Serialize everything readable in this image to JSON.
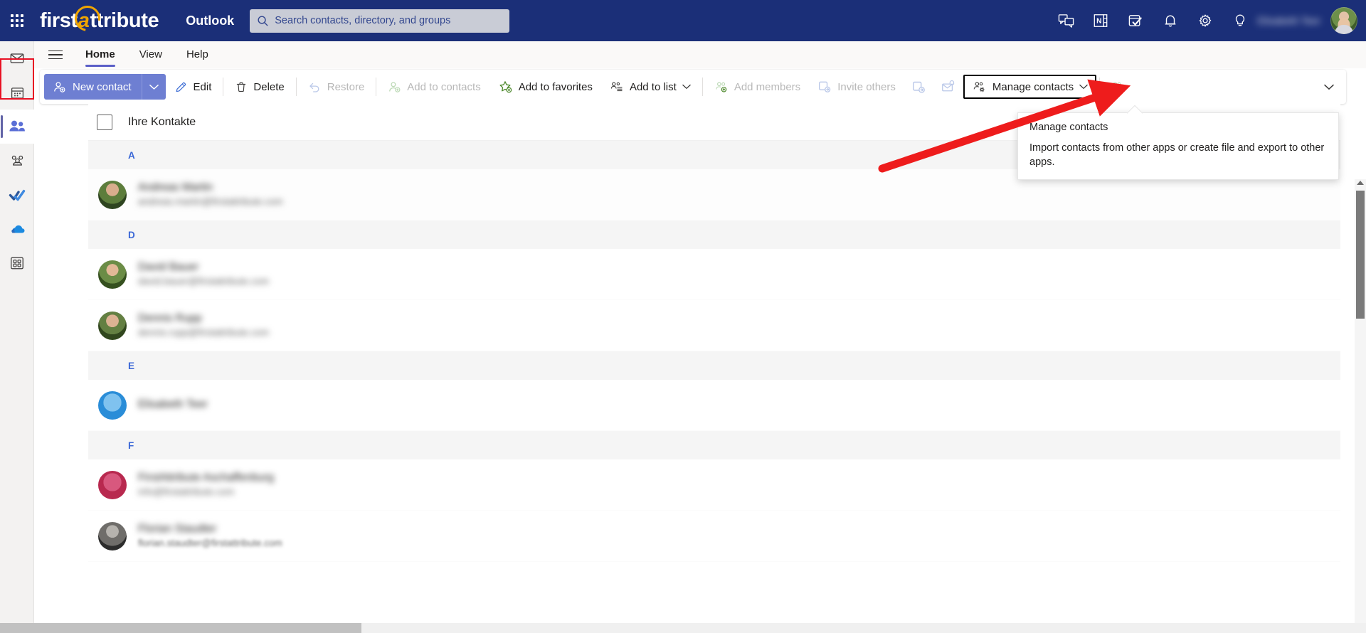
{
  "header": {
    "brand_first": "first",
    "brand_at": "a",
    "brand_rest": "ttribute",
    "app_name": "Outlook",
    "search_placeholder": "Search contacts, directory, and groups",
    "search_value": "",
    "user_name": "Elisabeth Teer",
    "icons": [
      {
        "name": "teams-chat-icon",
        "glyph": "chat"
      },
      {
        "name": "onenote-icon",
        "glyph": "onenote"
      },
      {
        "name": "todo-icon",
        "glyph": "todo"
      },
      {
        "name": "notifications-bell-icon",
        "glyph": "bell"
      },
      {
        "name": "settings-gear-icon",
        "glyph": "gear"
      },
      {
        "name": "tips-lightbulb-icon",
        "glyph": "bulb"
      }
    ]
  },
  "rail": {
    "items": [
      {
        "name": "mail",
        "label": "Mail",
        "selected": false
      },
      {
        "name": "calendar",
        "label": "Calendar",
        "selected": false
      },
      {
        "name": "people",
        "label": "People",
        "selected": true
      },
      {
        "name": "groups",
        "label": "Groups",
        "selected": false
      },
      {
        "name": "todo",
        "label": "To Do",
        "selected": false
      },
      {
        "name": "onedrive",
        "label": "OneDrive",
        "selected": false
      },
      {
        "name": "apps",
        "label": "All apps",
        "selected": false
      }
    ]
  },
  "ribbon": {
    "tabs": [
      {
        "label": "Home",
        "active": true
      },
      {
        "label": "View",
        "active": false
      },
      {
        "label": "Help",
        "active": false
      }
    ]
  },
  "toolbar": {
    "new_contact": "New contact",
    "items": [
      {
        "label": "Edit",
        "icon": "pencil-icon",
        "disabled": false,
        "chevron": false
      },
      {
        "label": "Delete",
        "icon": "trash-icon",
        "disabled": false,
        "chevron": false
      },
      {
        "label": "Restore",
        "icon": "undo-icon",
        "disabled": true,
        "chevron": false
      },
      {
        "label": "Add to contacts",
        "icon": "add-person-icon",
        "disabled": true,
        "chevron": false
      },
      {
        "label": "Add to favorites",
        "icon": "star-plus-icon",
        "disabled": false,
        "chevron": false
      },
      {
        "label": "Add to list",
        "icon": "list-people-icon",
        "disabled": false,
        "chevron": true
      },
      {
        "label": "Add members",
        "icon": "add-members-icon",
        "disabled": true,
        "chevron": false
      },
      {
        "label": "Invite others",
        "icon": "invite-icon",
        "disabled": true,
        "chevron": false
      }
    ],
    "icon_only": [
      {
        "name": "share-contact-icon",
        "disabled": true
      },
      {
        "name": "mail-alert-icon",
        "disabled": true
      }
    ],
    "manage_contacts": "Manage contacts",
    "trailing_icon": {
      "name": "manage-people-icon",
      "disabled": true
    },
    "overflow_label": "More commands"
  },
  "tooltip": {
    "title": "Manage contacts",
    "body": "Import contacts from other apps or create file and export to other apps."
  },
  "list": {
    "title": "Ihre Kontakte",
    "groups": [
      {
        "letter": "A",
        "contacts": [
          {
            "name": "Andreas Martin",
            "email": "andreas.martin@firstattribute.com",
            "avatar": "av-photo"
          }
        ]
      },
      {
        "letter": "D",
        "contacts": [
          {
            "name": "David Bauer",
            "email": "david.bauer@firstattribute.com",
            "avatar": "av-photo2"
          },
          {
            "name": "Dennis Rupp",
            "email": "dennis.rupp@firstattribute.com",
            "avatar": "av-photo3"
          }
        ]
      },
      {
        "letter": "E",
        "contacts": [
          {
            "name": "Elisabeth Teer",
            "email": "",
            "avatar": "av-blue"
          }
        ]
      },
      {
        "letter": "F",
        "contacts": [
          {
            "name": "FirstAttribute Aschaffenburg",
            "email": "info@firstattribute.com",
            "avatar": "av-pink"
          },
          {
            "name": "Florian Staudter",
            "email": "florian.staudter@firstattribute.com",
            "avatar": "av-grey"
          }
        ]
      }
    ]
  },
  "colors": {
    "brand_navy": "#1b2f78",
    "brand_gold": "#f0a500",
    "accent_blue": "#6e7fd2",
    "annotation_red": "#e81123",
    "group_letter": "#3a67d6"
  }
}
